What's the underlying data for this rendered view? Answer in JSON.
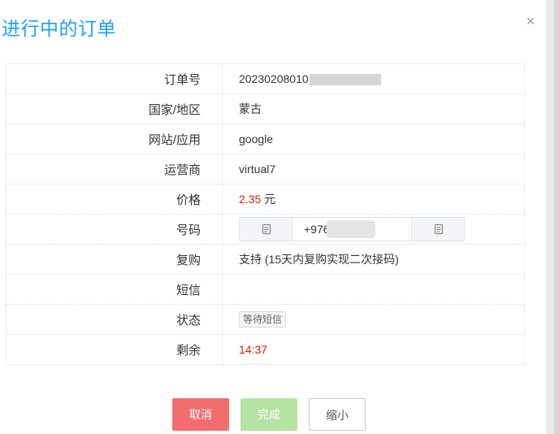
{
  "dialog": {
    "title": "进行中的订单",
    "close_icon": "close-icon"
  },
  "order": {
    "rows": [
      {
        "label": "订单号",
        "value": "20230208010"
      },
      {
        "label": "国家/地区",
        "value": "蒙古"
      },
      {
        "label": "网站/应用",
        "value": "google"
      },
      {
        "label": "运营商",
        "value": "virtual7"
      },
      {
        "label": "价格",
        "value": "2.35",
        "unit": "元"
      },
      {
        "label": "号码",
        "value": "+976"
      },
      {
        "label": "复购",
        "value": "支持 (15天内复购实现二次接码)"
      },
      {
        "label": "短信",
        "value": ""
      },
      {
        "label": "状态",
        "value": "等待短信"
      },
      {
        "label": "剩余",
        "value": "14:37"
      }
    ]
  },
  "colors": {
    "title": "#1e9fff",
    "price": "#d81e06",
    "cancel": "#f26e6e",
    "done": "#b5e3a4"
  },
  "buttons": {
    "cancel": "取消",
    "done": "完成",
    "minimize": "缩小"
  }
}
